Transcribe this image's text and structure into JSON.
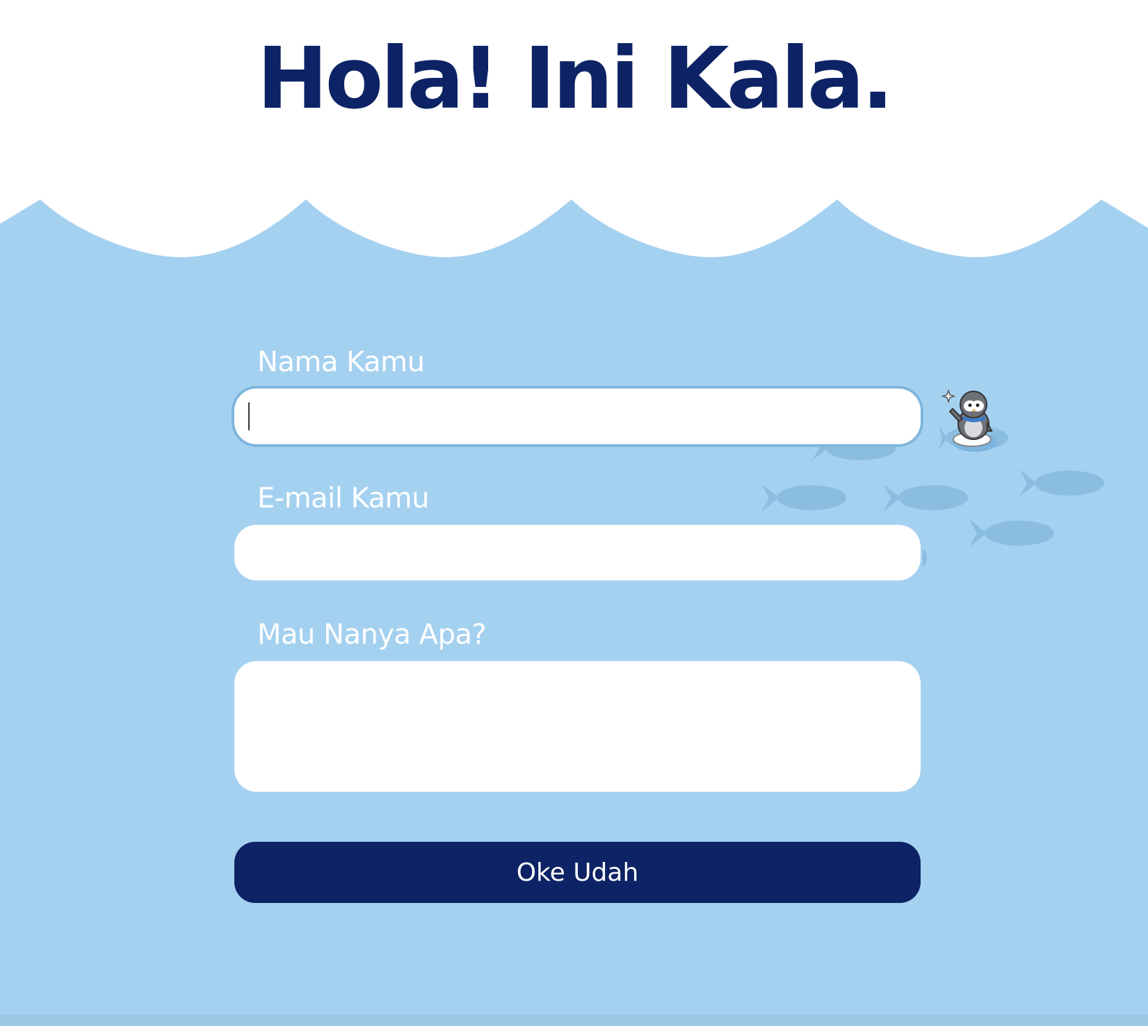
{
  "header": {
    "title": "Hola! Ini Kala."
  },
  "form": {
    "name": {
      "label": "Nama Kamu",
      "value": "",
      "placeholder": ""
    },
    "email": {
      "label": "E-mail Kamu",
      "value": "",
      "placeholder": ""
    },
    "question": {
      "label": "Mau Nanya Apa?",
      "value": "",
      "placeholder": ""
    },
    "submit_label": "Oke Udah"
  },
  "colors": {
    "title": "#0d2365",
    "water": "#a5d1f0",
    "fish": "#8bbde0",
    "button": "#0d2365",
    "input_focus_ring": "#7fb6dc"
  },
  "icons": {
    "mascot": "penguin-on-ice-icon",
    "fish": "fish-icon"
  }
}
